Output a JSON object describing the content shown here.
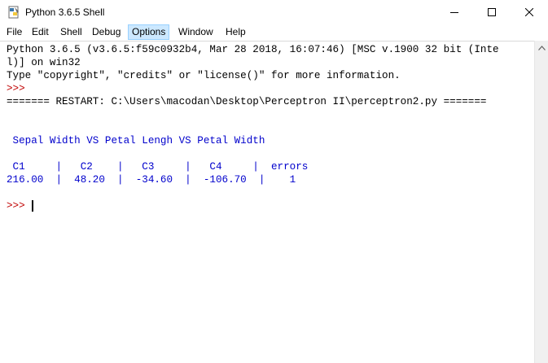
{
  "window": {
    "title": "Python 3.6.5 Shell",
    "icon": "python-idle-icon"
  },
  "menu": {
    "items": [
      {
        "label": "File"
      },
      {
        "label": "Edit"
      },
      {
        "label": "Shell"
      },
      {
        "label": "Debug"
      },
      {
        "label": "Options",
        "active": true
      },
      {
        "label": "Window"
      },
      {
        "label": "Help"
      }
    ]
  },
  "shell": {
    "banner_line1": "Python 3.6.5 (v3.6.5:f59c0932b4, Mar 28 2018, 16:07:46) [MSC v.1900 32 bit (Inte",
    "banner_line2": "l)] on win32",
    "banner_line3": "Type \"copyright\", \"credits\" or \"license()\" for more information.",
    "prompt1": ">>>",
    "restart_line": "======= RESTART: C:\\Users\\macodan\\Desktop\\Perceptron II\\perceptron2.py =======",
    "output_title": " Sepal Width VS Petal Lengh VS Petal Width",
    "table_header": " C1     |   C2    |   C3     |   C4     |  errors",
    "table_row": "216.00  |  48.20  |  -34.60  |  -106.70  |    1",
    "prompt2": ">>>"
  },
  "colors": {
    "prompt": "#c00000",
    "program_output": "#0000cc",
    "menu_highlight": "#cce8ff"
  }
}
